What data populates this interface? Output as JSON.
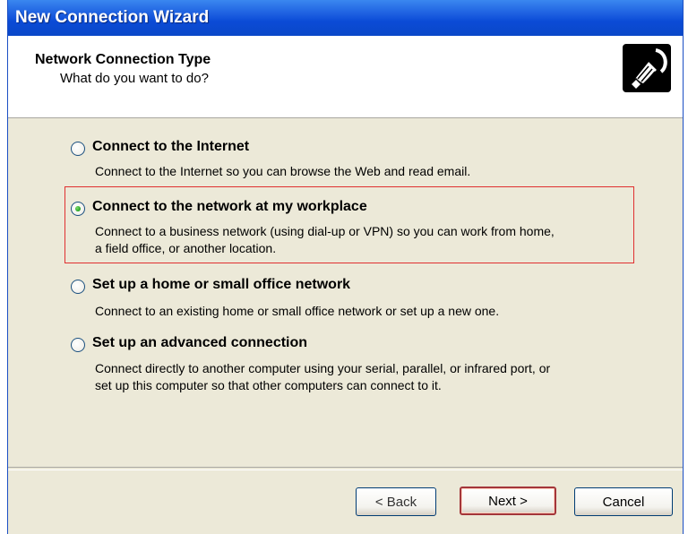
{
  "window": {
    "title": "New Connection Wizard"
  },
  "header": {
    "title": "Network Connection Type",
    "subtitle": "What do you want to do?",
    "icon": "network-cable-icon"
  },
  "options": [
    {
      "label": "Connect to the Internet",
      "description": [
        "Connect to the Internet so you can browse the Web and read email."
      ],
      "selected": false
    },
    {
      "label": "Connect to the network at my workplace",
      "description": [
        "Connect to a business network (using dial-up or VPN) so you can work from home,",
        "a field office, or another location."
      ],
      "selected": true
    },
    {
      "label": "Set up a home or small office network",
      "description": [
        "Connect to an existing home or small office network or set up a new one."
      ],
      "selected": false
    },
    {
      "label": "Set up an advanced connection",
      "description": [
        "Connect directly to another computer using your serial, parallel, or infrared port, or",
        "set up this computer so that other computers can connect to it."
      ],
      "selected": false
    }
  ],
  "buttons": {
    "back": "< Back",
    "next": "Next >",
    "cancel": "Cancel"
  },
  "colors": {
    "titlebar": "#0b4bd6",
    "focus_border": "#e03030",
    "default_button_border": "#a3363a"
  }
}
